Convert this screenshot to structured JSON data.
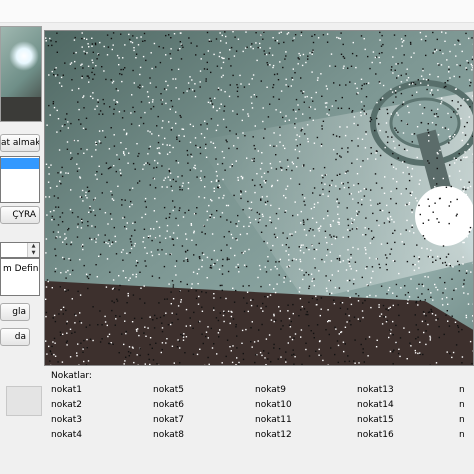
{
  "buttons": {
    "capture_label": "at almak",
    "cyra_label": "ÇYRA",
    "btn1_label": "gla",
    "btn2_label": "da"
  },
  "combo": {
    "value": "m Definiti"
  },
  "points_panel": {
    "title": "Nokatlar:",
    "columns": [
      [
        "nokat1",
        "nokat2",
        "nokat3",
        "nokat4"
      ],
      [
        "nokat5",
        "nokat6",
        "nokat7",
        "nokat8"
      ],
      [
        "nokat9",
        "nokat10",
        "nokat11",
        "nokat12"
      ],
      [
        "nokat13",
        "nokat14",
        "nokat15",
        "nokat16"
      ]
    ]
  },
  "colors": {
    "selection": "#3399ff",
    "viewer_base": "#6f8a86"
  }
}
